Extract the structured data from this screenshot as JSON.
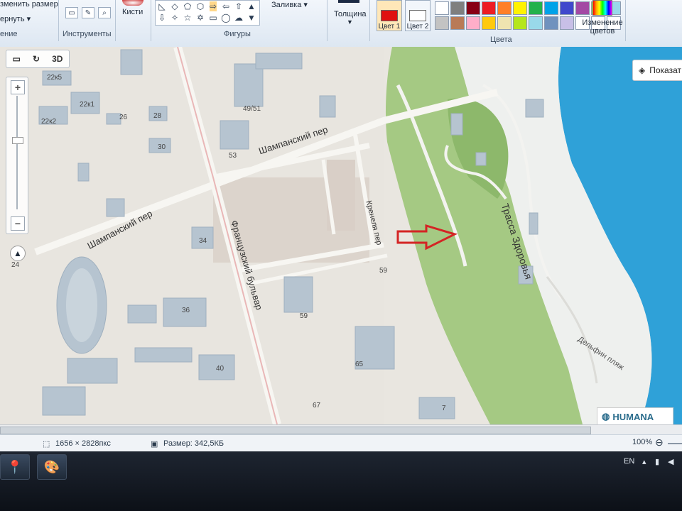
{
  "ribbon": {
    "resize_label": "зменить размер",
    "rotate_label": "ернуть ▾",
    "image_group": "ение",
    "tools_group": "Инструменты",
    "brushes_label": "Кисти",
    "shapes_group": "Фигуры",
    "fill_label": "Заливка ▾",
    "thickness_label": "Толщина",
    "color1_label": "Цвет 1",
    "color2_label": "Цвет 2",
    "colors_group": "Цвета",
    "edit_colors_label": "Изменение цветов",
    "palette": [
      "#ffffff",
      "#7f7f7f",
      "#880015",
      "#ed1c24",
      "#ff7f27",
      "#fff200",
      "#22b14c",
      "#00a2e8",
      "#3f48cc",
      "#a349a4",
      "#b5e61d",
      "#99d9ea",
      "#c3c3c3",
      "#b97a57",
      "#ffaec9",
      "#ffc90e",
      "#efe4b0",
      "#b5e61d",
      "#99d9ea",
      "#7092be",
      "#c8bfe7",
      "#ffffff",
      "#ffffff",
      "#ffffff"
    ],
    "color1_value": "#e01010",
    "color2_value": "#ffffff"
  },
  "map": {
    "view_3d": "3D",
    "show_button": "Показат",
    "labels": {
      "street_shampansky_top": "Шампанский пер",
      "street_shampansky_left": "Шампанский пер",
      "street_french": "Французский бульвар",
      "street_krennelya": "Кренеля пер",
      "street_health": "Трасса Здоровья",
      "beach": "Дельфин пляж",
      "b_22k5": "22к5",
      "b_22k1": "22к1",
      "b_22k2": "22к2",
      "b_26": "26",
      "b_28": "28",
      "b_30": "30",
      "b_49_51": "49/51",
      "b_53": "53",
      "b_34": "34",
      "b_36": "36",
      "b_40": "40",
      "b_59a": "59",
      "b_59b": "59",
      "b_65": "65",
      "b_67": "67",
      "b_7": "7",
      "b_24": "24"
    },
    "logo": "HUMANA",
    "arrow_color": "#d42424"
  },
  "status": {
    "dimensions": "1656 × 2828пкс",
    "size": "Размер: 342,5КБ",
    "zoom": "100%"
  },
  "taskbar": {
    "lang": "EN"
  }
}
